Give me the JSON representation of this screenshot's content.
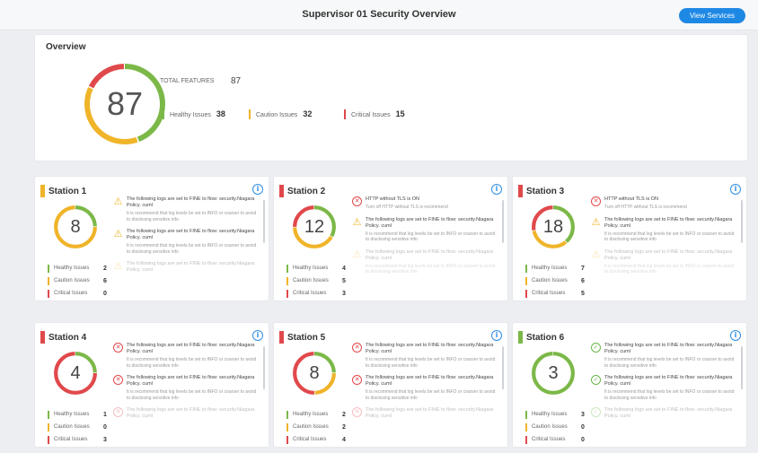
{
  "header": {
    "title": "Supervisor 01 Security Overview",
    "view_services_label": "View Services"
  },
  "overview": {
    "title": "Overview",
    "total": "87",
    "total_label": "TOTAL FEATURES",
    "total_value": "87",
    "healthy_label": "Healthy Issues",
    "healthy": "38",
    "caution_label": "Caution Issues",
    "caution": "32",
    "critical_label": "Critical Issues",
    "critical": "15"
  },
  "colors": {
    "healthy": "#7cb848",
    "caution": "#f0b429",
    "critical": "#e0494c",
    "accent": "#1e88e5"
  },
  "stations": [
    {
      "name": "Station 1",
      "status": "caution",
      "total": "8",
      "healthy": "2",
      "caution": "6",
      "critical": "0",
      "messages": [
        {
          "type": "warn",
          "title": "The following logs are set to FINE to flow: security.Niagara Policy. cuml",
          "sub": "It is recommend that log levels be set to INFO or coarser to avoid to disclosing sensitive info"
        },
        {
          "type": "warn",
          "title": "The following logs are set to FINE to flow: security.Niagara Policy. cuml",
          "sub": "It is recommend that log levels be set to INFO or coarser to avoid to disclosing sensitive info"
        },
        {
          "type": "warn",
          "title": "The following logs are set to FINE to flow: security.Niagara Policy. cuml",
          "sub": ""
        }
      ]
    },
    {
      "name": "Station 2",
      "status": "critical",
      "total": "12",
      "healthy": "4",
      "caution": "5",
      "critical": "3",
      "messages": [
        {
          "type": "err",
          "title": "HTTP without TLS is ON",
          "sub": "Turn off HTTP without TLS is recommend"
        },
        {
          "type": "warn",
          "title": "The following logs are set to FINE to flow: security.Niagara Policy. cuml",
          "sub": "It is recommend that log levels be set to INFO or coarser to avoid to disclosing sensitive info"
        },
        {
          "type": "warn",
          "title": "The following logs are set to FINE to flow: security.Niagara Policy. cuml",
          "sub": "It is recommend that log levels be set to INFO or coarser to avoid to disclosing sensitive info"
        }
      ]
    },
    {
      "name": "Station 3",
      "status": "critical",
      "total": "18",
      "healthy": "7",
      "caution": "6",
      "critical": "5",
      "messages": [
        {
          "type": "err",
          "title": "HTTP without TLS is ON",
          "sub": "Turn off HTTP without TLS is recommend"
        },
        {
          "type": "warn",
          "title": "The following logs are set to FINE to flow: security.Niagara Policy. cuml",
          "sub": "It is recommend that log levels be set to INFO or coarser to avoid to disclosing sensitive info"
        },
        {
          "type": "warn",
          "title": "The following logs are set to FINE to flow: security.Niagara Policy. cuml",
          "sub": "It is recommend that log levels be set to INFO or coarser to avoid to disclosing sensitive info"
        }
      ]
    },
    {
      "name": "Station 4",
      "status": "critical",
      "total": "4",
      "healthy": "1",
      "caution": "0",
      "critical": "3",
      "messages": [
        {
          "type": "err",
          "title": "The following logs are set to FINE to flow: security.Niagara Policy. cuml",
          "sub": "It is recommend that log levels be set to INFO or coarser to avoid to disclosing sensitive info"
        },
        {
          "type": "err",
          "title": "The following logs are set to FINE to flow: security.Niagara Policy. cuml",
          "sub": "It is recommend that log levels be set to INFO or coarser to avoid to disclosing sensitive info"
        },
        {
          "type": "err",
          "title": "The following logs are set to FINE to flow: security.Niagara Policy. cuml",
          "sub": ""
        }
      ]
    },
    {
      "name": "Station 5",
      "status": "critical",
      "total": "8",
      "healthy": "2",
      "caution": "2",
      "critical": "4",
      "messages": [
        {
          "type": "err",
          "title": "The following logs are set to FINE to flow: security.Niagara Policy. cuml",
          "sub": "It is recommend that log levels be set to INFO or coarser to avoid to disclosing sensitive info"
        },
        {
          "type": "err",
          "title": "The following logs are set to FINE to flow: security.Niagara Policy. cuml",
          "sub": "It is recommend that log levels be set to INFO or coarser to avoid to disclosing sensitive info"
        },
        {
          "type": "err",
          "title": "The following logs are set to FINE to flow: security.Niagara Policy. cuml",
          "sub": ""
        }
      ]
    },
    {
      "name": "Station 6",
      "status": "healthy",
      "total": "3",
      "healthy": "3",
      "caution": "0",
      "critical": "0",
      "messages": [
        {
          "type": "ok",
          "title": "The following logs are set to FINE to flow: security.Niagara Policy. cuml",
          "sub": "It is recommend that log levels be set to INFO or coarser to avoid to disclosing sensitive info"
        },
        {
          "type": "ok",
          "title": "The following logs are set to FINE to flow: security.Niagara Policy. cuml",
          "sub": "It is recommend that log levels be set to INFO or coarser to avoid to disclosing sensitive info"
        },
        {
          "type": "ok",
          "title": "The following logs are set to FINE to flow: security.Niagara Policy. cuml",
          "sub": ""
        }
      ]
    }
  ],
  "station_labels": {
    "healthy": "Healthy Issues",
    "caution": "Caution Issues",
    "critical": "Critical Issues"
  },
  "icons": {
    "info": "info-icon",
    "warn": "warning-triangle-icon",
    "err": "error-circle-icon",
    "ok": "check-circle-icon"
  }
}
